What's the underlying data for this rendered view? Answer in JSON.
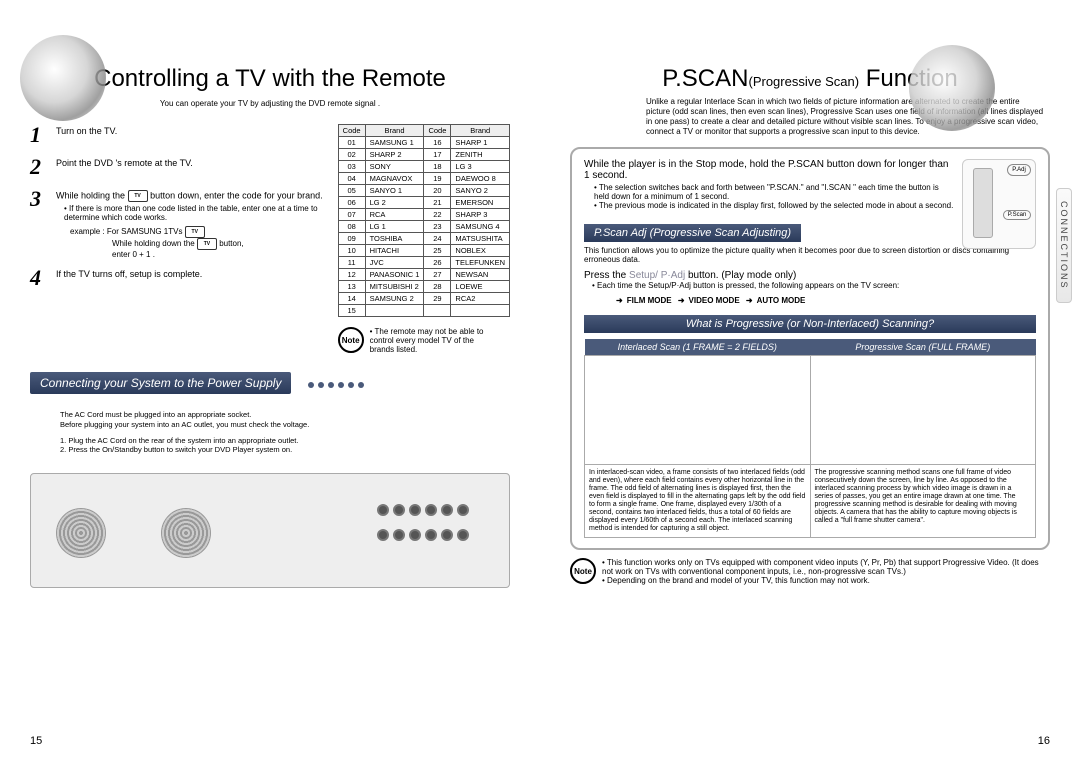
{
  "left": {
    "title": "Controlling a TV with the Remote",
    "subtitle": "You can operate your TV by adjusting the DVD remote signal .",
    "steps": [
      {
        "num": "1",
        "text": "Turn on the TV."
      },
      {
        "num": "2",
        "text": "Point the DVD 's remote at the TV."
      },
      {
        "num": "3",
        "text_a": "While holding the",
        "text_b": "button down, enter the code for your brand.",
        "bullet": "If there is more than one code listed in the table, enter one at a time to determine which code works.",
        "example_label": "example : For SAMSUNG 1TVs",
        "example_line": "While holding down the",
        "example_suffix": "button,",
        "example_enter": "enter  0  +  1  ."
      },
      {
        "num": "4",
        "text": "If the TV turns off, setup is complete."
      }
    ],
    "tv_icon": "TV",
    "table": {
      "headers": [
        "Code",
        "Brand",
        "Code",
        "Brand"
      ],
      "rows": [
        [
          "01",
          "SAMSUNG 1",
          "16",
          "SHARP 1"
        ],
        [
          "02",
          "SHARP 2",
          "17",
          "ZENITH"
        ],
        [
          "03",
          "SONY",
          "18",
          "LG 3"
        ],
        [
          "04",
          "MAGNAVOX",
          "19",
          "DAEWOO 8"
        ],
        [
          "05",
          "SANYO 1",
          "20",
          "SANYO 2"
        ],
        [
          "06",
          "LG 2",
          "21",
          "EMERSON"
        ],
        [
          "07",
          "RCA",
          "22",
          "SHARP 3"
        ],
        [
          "08",
          "LG 1",
          "23",
          "SAMSUNG 4"
        ],
        [
          "09",
          "TOSHIBA",
          "24",
          "MATSUSHITA"
        ],
        [
          "10",
          "HITACHI",
          "25",
          "NOBLEX"
        ],
        [
          "11",
          "JVC",
          "26",
          "TELEFUNKEN"
        ],
        [
          "12",
          "PANASONIC 1",
          "27",
          "NEWSAN"
        ],
        [
          "13",
          "MITSUBISHI 2",
          "28",
          "LOEWE"
        ],
        [
          "14",
          "SAMSUNG 2",
          "29",
          "RCA2"
        ],
        [
          "15",
          "",
          "",
          ""
        ]
      ]
    },
    "note_label": "Note",
    "note": "The remote may not be able to control every model TV of the brands listed.",
    "section2": "Connecting your System to the Power Supply",
    "power_a": "The AC Cord must be plugged into an appropriate socket.",
    "power_b": "Before plugging your system into an AC outlet, you must check the voltage.",
    "power_1": "1. Plug the AC Cord on the rear of the system into an appropriate outlet.",
    "power_2": "2. Press the On/Standby button to switch your DVD Player system on.",
    "page_num": "15"
  },
  "right": {
    "title_a": "P.SCAN",
    "title_b": "(Progressive Scan)",
    "title_c": "Function",
    "intro": "Unlike a regular Interlace Scan in which two fields of picture information are alternated to create the entire picture (odd scan lines, then even scan lines), Progressive Scan uses one field of information (all lines displayed in one pass) to create a clear and detailed picture without visible scan lines. To enjoy a progressive scan video, connect a TV or monitor that supports a progressive scan input to this device.",
    "side_tab": "CONNECTIONS",
    "remote_labels": {
      "padj": "P.Adj",
      "pscan": "P.Scan"
    },
    "hold_a": "While the player is in the Stop mode, hold the P.SCAN button down for longer than 1 second.",
    "hold_b1": "The selection switches back and forth between \"P.SCAN.\" and \"I.SCAN \" each time the button is held down for a minimum of 1 second.",
    "hold_b2": "The previous mode is indicated in the display first, followed by the selected mode in about a second.",
    "adj_bar": "P.Scan Adj (Progressive Scan Adjusting)",
    "adj_desc": "This function allows you to optimize the picture quality when it becomes poor due to screen distortion or discs containing erroneous data.",
    "press_a": "Press the",
    "press_btn": "Setup/ P·Adj",
    "press_b": "button. (Play mode only)",
    "press_sub": "Each time the Setup/P·Adj button is pressed, the following appears on the TV screen:",
    "modes": [
      "FILM MODE",
      "VIDEO MODE",
      "AUTO MODE"
    ],
    "whatis": "What is Progressive (or Non-Interlaced) Scanning?",
    "col1_h": "Interlaced Scan (1 FRAME = 2 FIELDS)",
    "col2_h": "Progressive Scan (FULL FRAME)",
    "col1_t": "In interlaced-scan video, a frame consists of two interlaced fields (odd and even), where each field contains every other horizontal line in the frame. The odd field of alternating lines is displayed first, then the even field is displayed to fill in the alternating gaps left by the odd field to form a single frame. One frame, displayed every 1/30th of a second, contains two interlaced fields, thus a total of 60 fields are displayed every 1/60th of a second each. The interlaced scanning method is intended for capturing a still object.",
    "col2_t": "The progressive scanning method scans one full frame of video consecutively down the screen, line by line. As opposed to the interlaced scanning process by which video image is drawn in a series of passes, you get an entire image drawn at one time. The progressive scanning method is desirable for dealing with moving objects. A camera that has the ability to capture moving objects is called a \"full frame shutter camera\".",
    "note_label": "Note",
    "foot_1": "This function works only on TVs equipped with component video inputs (Y, Pr, Pb) that support Progressive Video. (It does not work on TVs with conventional component inputs, i.e., non-progressive scan TVs.)",
    "foot_2": "Depending on the brand and model of your TV, this function may not work.",
    "page_num": "16"
  }
}
